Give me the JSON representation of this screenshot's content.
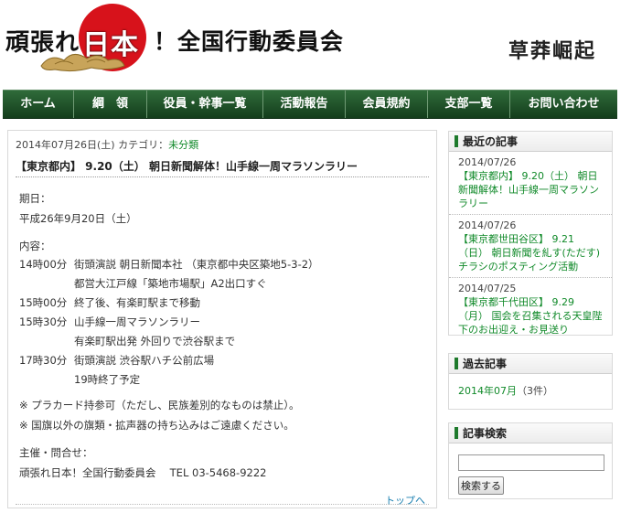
{
  "header": {
    "title_left": "頑張れ",
    "title_nihon": "日本",
    "title_right": "！全国行動委員会",
    "slogan": "草莽崛起"
  },
  "nav": {
    "items": [
      {
        "label": "ホーム"
      },
      {
        "label": "綱　領"
      },
      {
        "label": "役員・幹事一覧"
      },
      {
        "label": "活動報告"
      },
      {
        "label": "会員規約"
      },
      {
        "label": "支部一覧"
      },
      {
        "label": "お問い合わせ"
      }
    ]
  },
  "post": {
    "meta_date": "2014年07月26日(土) カテゴリ：",
    "meta_category": "未分類",
    "title": "【東京都内】 9.20（土） 朝日新聞解体！山手線一周マラソンラリー",
    "body": {
      "date_label": "期日：",
      "date_value": "平成26年9月20日（土）",
      "content_label": "内容：",
      "schedule": [
        {
          "time": "14時00分",
          "text": "街頭演説 朝日新聞本社 （東京都中央区築地5-3-2）"
        },
        {
          "time": "",
          "text": "都営大江戸線「築地市場駅」A2出口すぐ"
        },
        {
          "time": "15時00分",
          "text": "終了後、有楽町駅まで移動"
        },
        {
          "time": "15時30分",
          "text": "山手線一周マラソンラリー"
        },
        {
          "time": "",
          "text": "有楽町駅出発 外回りで渋谷駅まで"
        },
        {
          "time": "17時30分",
          "text": "街頭演説 渋谷駅ハチ公前広場"
        },
        {
          "time": "",
          "text": "19時終了予定"
        }
      ],
      "note_1": "※ プラカード持参可（ただし、民族差別的なものは禁止）。",
      "note_2": "※ 国旗以外の旗類・拡声器の持ち込みはご遠慮ください。",
      "organizer_label": "主催・問合せ：",
      "organizer_value": "頑張れ日本！全国行動委員会　 TEL 03-5468-9222"
    },
    "pagetop": "トップへ"
  },
  "sidebar": {
    "recent": {
      "heading": "最近の記事",
      "items": [
        {
          "date": "2014/07/26",
          "title": "【東京都内】 9.20（土） 朝日新聞解体！山手線一周マラソンラリー"
        },
        {
          "date": "2014/07/26",
          "title": "【東京都世田谷区】 9.21（日） 朝日新聞を糺す(ただす)チラシのポスティング活動"
        },
        {
          "date": "2014/07/25",
          "title": "【東京都千代田区】 9.29（月） 国会を召集される天皇陛下のお出迎え・お見送り"
        }
      ]
    },
    "archive": {
      "heading": "過去記事",
      "link": "2014年07月",
      "count": "（3件）"
    },
    "search": {
      "heading": "記事検索",
      "button": "検索する",
      "placeholder": ""
    }
  },
  "colors": {
    "nav_green": "#1e5428",
    "link_green": "#118a2a",
    "logo_red": "#d7121b"
  }
}
